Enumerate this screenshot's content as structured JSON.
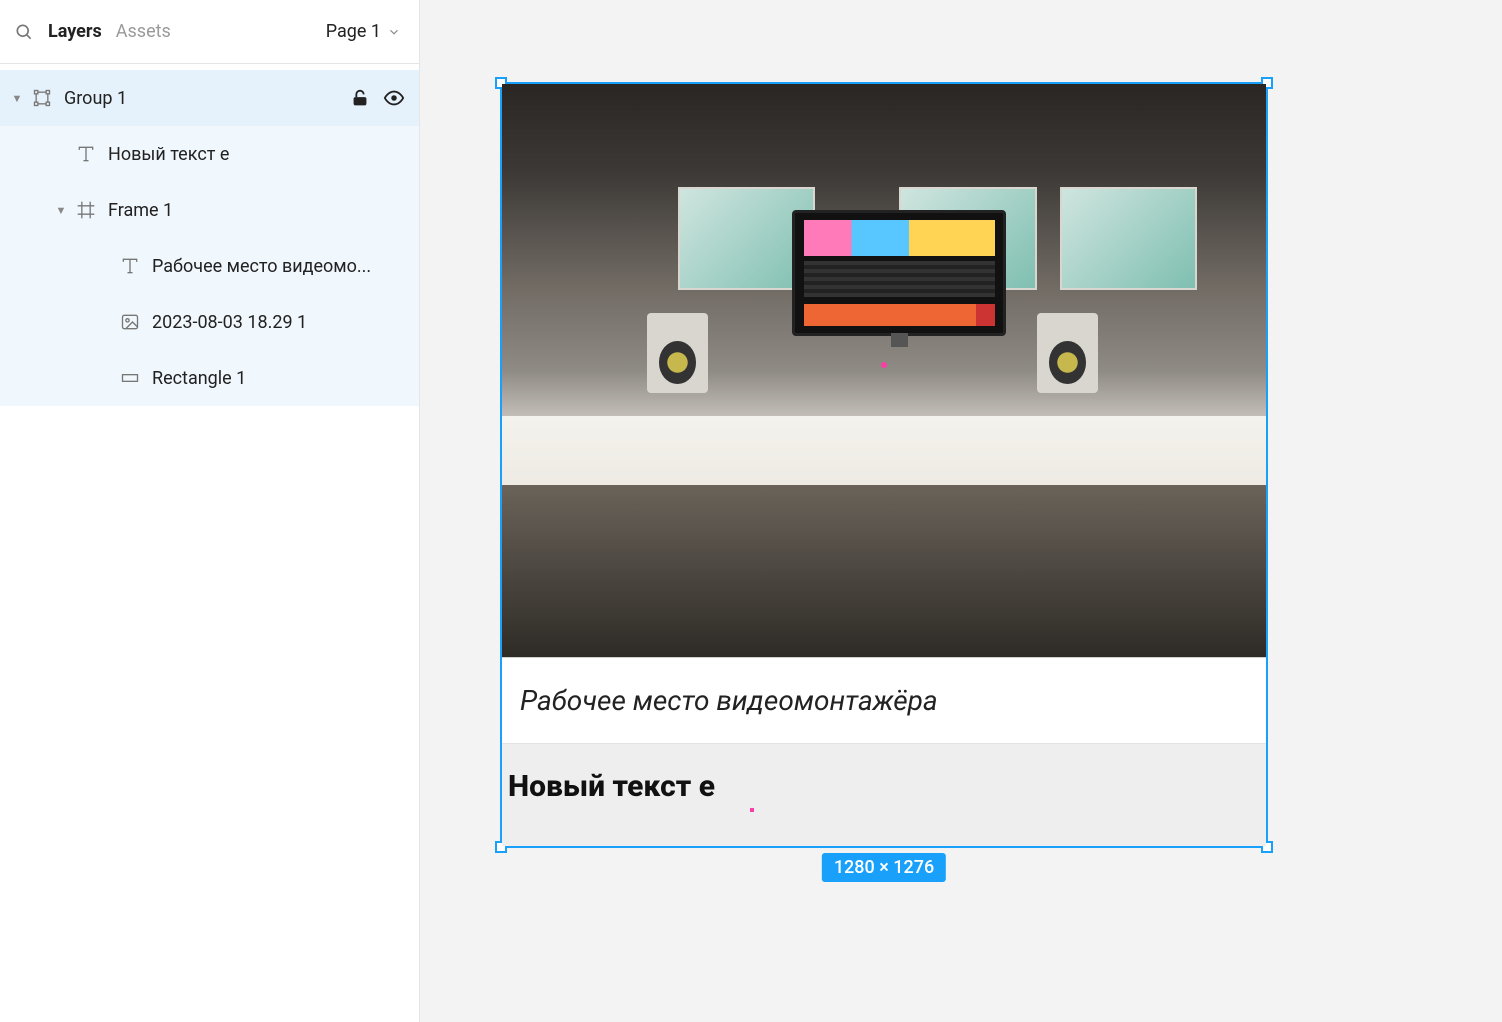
{
  "tabs": {
    "layers": "Layers",
    "assets": "Assets"
  },
  "page_selector": {
    "label": "Page 1"
  },
  "layers": [
    {
      "name": "Group 1",
      "depth": 0,
      "icon": "group",
      "expanded": true,
      "selected": true,
      "locked": false,
      "visible": true
    },
    {
      "name": "Новый текст е",
      "depth": 1,
      "icon": "text"
    },
    {
      "name": "Frame 1",
      "depth": 1,
      "icon": "frame",
      "expanded": true
    },
    {
      "name": "Рабочее место видеомо...",
      "depth": 2,
      "icon": "text"
    },
    {
      "name": "2023-08-03 18.29 1",
      "depth": 2,
      "icon": "image"
    },
    {
      "name": "Rectangle 1",
      "depth": 2,
      "icon": "rect"
    }
  ],
  "canvas": {
    "caption": "Рабочее место видеомонтажёра",
    "text_block": "Новый текст е",
    "selection_dims": "1280 × 1276"
  }
}
